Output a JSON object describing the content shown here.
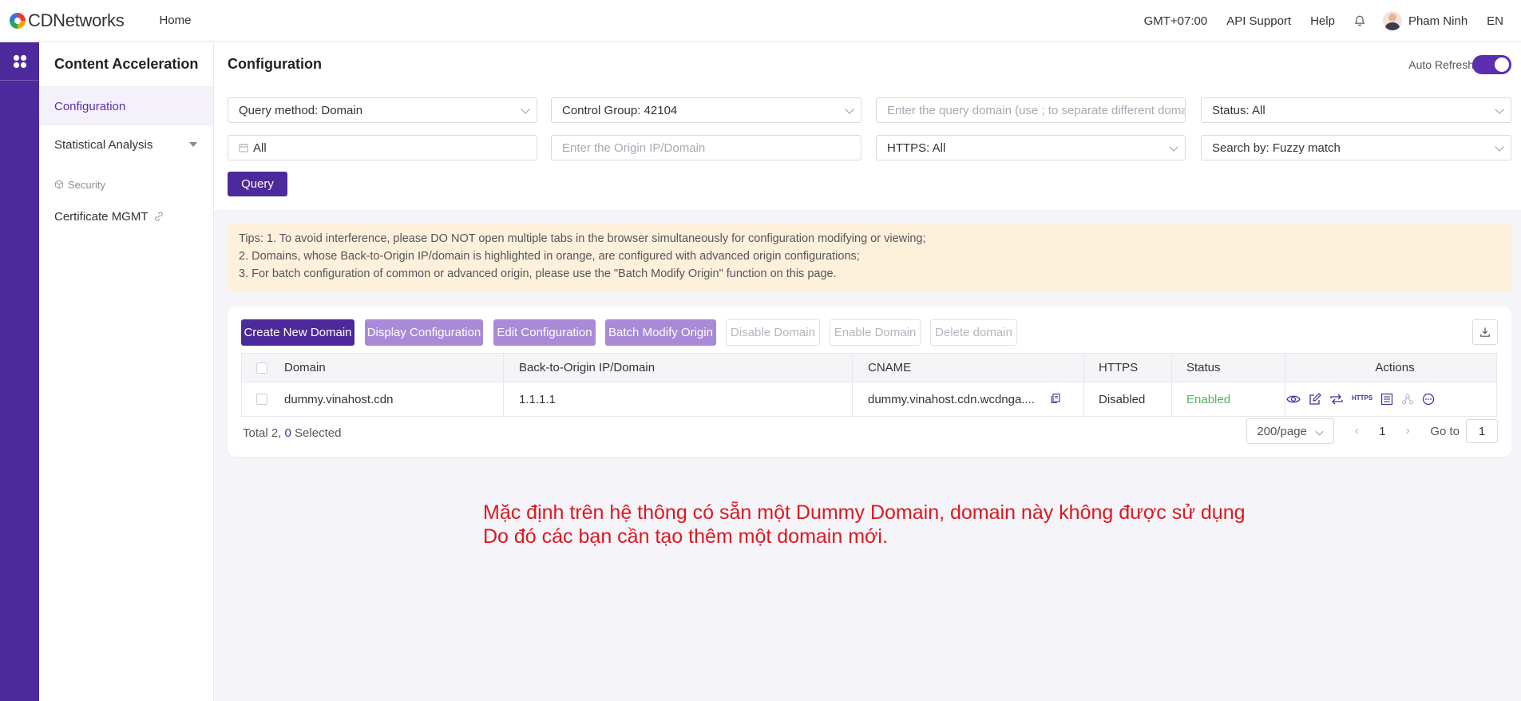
{
  "topbar": {
    "brand": "CDNetworks",
    "home": "Home",
    "timezone": "GMT+07:00",
    "api_support": "API Support",
    "help": "Help",
    "user_name": "Pham Ninh",
    "language": "EN"
  },
  "sidebar": {
    "title": "Content Acceleration",
    "items": [
      {
        "label": "Configuration",
        "active": true
      },
      {
        "label": "Statistical Analysis",
        "active": false
      }
    ],
    "section_security": "Security",
    "certificate": "Certificate MGMT"
  },
  "page": {
    "title": "Configuration",
    "auto_refresh": "Auto Refresh"
  },
  "filters": {
    "query_method": "Query method: Domain",
    "control_group": "Control Group: 42104",
    "domain_placeholder": "Enter the query domain (use ; to separate different domains)",
    "status": "Status: All",
    "date": "All",
    "origin_placeholder": "Enter the Origin IP/Domain",
    "https": "HTTPS: All",
    "search_by": "Search by: Fuzzy match",
    "query_button": "Query"
  },
  "tips": {
    "line1": "Tips: 1. To avoid interference, please DO NOT open multiple tabs in the browser simultaneously for configuration modifying or viewing;",
    "line2": "2. Domains, whose Back-to-Origin IP/domain is highlighted in orange, are configured with advanced origin configurations;",
    "line3": "3. For batch configuration of common or advanced origin, please use the \"Batch Modify Origin\" function on this page."
  },
  "toolbar": {
    "create": "Create New Domain",
    "display": "Display Configuration",
    "edit": "Edit Configuration",
    "batch": "Batch Modify Origin",
    "disable": "Disable Domain",
    "enable": "Enable Domain",
    "delete": "Delete domain"
  },
  "table": {
    "headers": {
      "domain": "Domain",
      "origin": "Back-to-Origin IP/Domain",
      "cname": "CNAME",
      "https": "HTTPS",
      "status": "Status",
      "actions": "Actions"
    },
    "rows": [
      {
        "domain": "dummy.vinahost.cdn",
        "origin": "1.1.1.1",
        "cname": "dummy.vinahost.cdn.wcdnga....",
        "https": "Disabled",
        "status": "Enabled"
      }
    ],
    "https_action": "HTTPS"
  },
  "footer": {
    "total_prefix": "Total 2, ",
    "selected_count": "0",
    "selected_suffix": " Selected",
    "page_size": "200/page",
    "current_page": "1",
    "goto_label": "Go to",
    "goto_value": "1"
  },
  "annotation": {
    "line1": "Mặc định trên hệ thông có sẵn một Dummy Domain, domain này không được sử dụng",
    "line2": "Do đó các bạn cần tạo thêm một domain mới."
  },
  "colors": {
    "brand": "#4d2a9c",
    "accent_light": "#a98ad9",
    "enabled": "#52b45e",
    "annotation": "#e0161e",
    "tips_bg": "#fdf1dc"
  }
}
